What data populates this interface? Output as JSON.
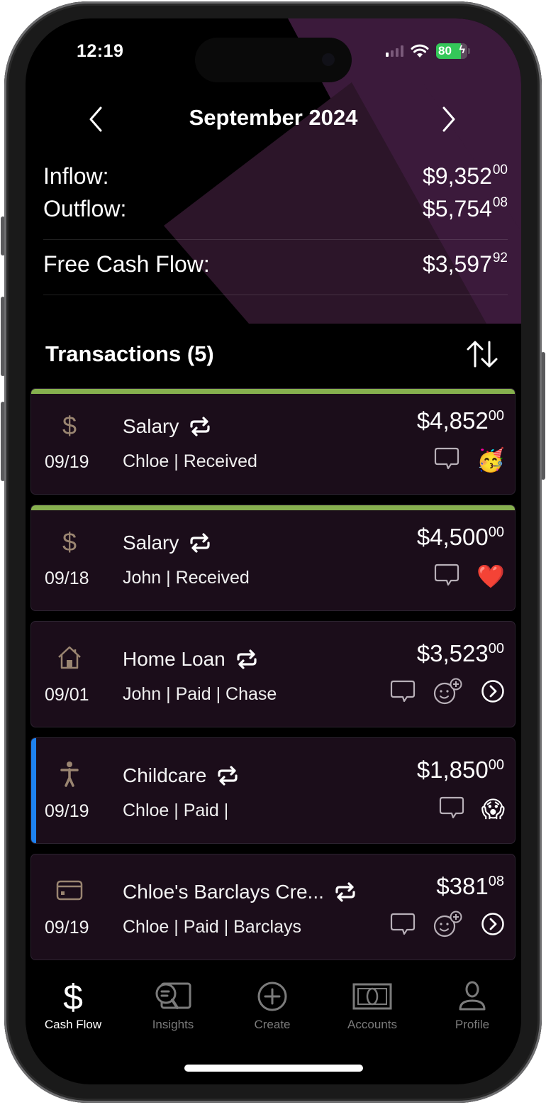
{
  "status_bar": {
    "time": "12:19",
    "battery_percent": 80,
    "battery_label": "80",
    "charging": true,
    "signal_bars_active": 1,
    "signal_bars_total": 4
  },
  "header": {
    "month_title": "September 2024",
    "prev_icon": "chevron-left-icon",
    "next_icon": "chevron-right-icon"
  },
  "summary": {
    "inflow": {
      "label": "Inflow:",
      "dollars": "$9,352",
      "cents": "00"
    },
    "outflow": {
      "label": "Outflow:",
      "dollars": "$5,754",
      "cents": "08"
    },
    "free_cash_flow": {
      "label": "Free Cash Flow:",
      "dollars": "$3,597",
      "cents": "92"
    }
  },
  "transactions": {
    "title": "Transactions (5)",
    "sort_icon": "sort-arrows-icon",
    "items": [
      {
        "icon": "dollar-icon",
        "name": "Salary",
        "recurring": true,
        "date": "09/19",
        "meta": "Chloe | Received",
        "dollars": "$4,852",
        "cents": "00",
        "reaction": "🥳",
        "accent": "top-green",
        "actions": [
          "comment"
        ]
      },
      {
        "icon": "dollar-icon",
        "name": "Salary",
        "recurring": true,
        "date": "09/18",
        "meta": "John | Received",
        "dollars": "$4,500",
        "cents": "00",
        "reaction": "❤️",
        "accent": "top-green",
        "actions": [
          "comment"
        ]
      },
      {
        "icon": "house-icon",
        "name": "Home Loan",
        "recurring": true,
        "date": "09/01",
        "meta": "John | Paid | Chase",
        "dollars": "$3,523",
        "cents": "00",
        "reaction": null,
        "accent": "none",
        "actions": [
          "comment",
          "add-reaction",
          "open"
        ]
      },
      {
        "icon": "person-icon",
        "name": "Childcare",
        "recurring": true,
        "date": "09/19",
        "meta": "Chloe | Paid |",
        "dollars": "$1,850",
        "cents": "00",
        "reaction": "😱",
        "accent": "left-blue",
        "actions": [
          "comment"
        ]
      },
      {
        "icon": "credit-card-icon",
        "name": "Chloe's Barclays Cre...",
        "recurring": true,
        "date": "09/19",
        "meta": "Chloe | Paid | Barclays",
        "dollars": "$381",
        "cents": "08",
        "reaction": null,
        "accent": "none",
        "actions": [
          "comment",
          "add-reaction",
          "open"
        ]
      }
    ]
  },
  "tabbar": {
    "items": [
      {
        "label": "Cash Flow",
        "icon": "dollar-icon",
        "active": true
      },
      {
        "label": "Insights",
        "icon": "insights-icon",
        "active": false
      },
      {
        "label": "Create",
        "icon": "plus-circle-icon",
        "active": false
      },
      {
        "label": "Accounts",
        "icon": "banknote-icon",
        "active": false
      },
      {
        "label": "Profile",
        "icon": "person-outline-icon",
        "active": false
      }
    ]
  },
  "colors": {
    "income_accent": "#86b04e",
    "highlight_accent": "#1e82f0",
    "card_bg": "#1b0d1a",
    "purple_light": "#3b1a3b",
    "purple_dark": "#2c1529",
    "category_icon": "#9a8571",
    "battery_green": "#34c759"
  }
}
